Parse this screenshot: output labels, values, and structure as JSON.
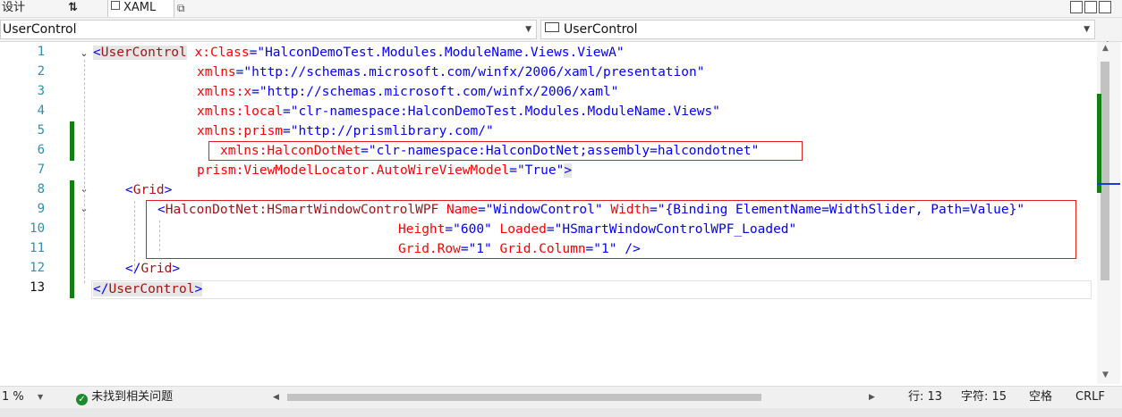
{
  "tabs": {
    "design": "设计",
    "swap_icon": "⇅",
    "xaml": "XAML",
    "open_icon": "popout-icon"
  },
  "nav": {
    "left_combo": "UserControl",
    "right_combo": "UserControl",
    "split_icon": "⇟"
  },
  "line_numbers": [
    "1",
    "2",
    "3",
    "4",
    "5",
    "6",
    "7",
    "8",
    "9",
    "10",
    "11",
    "12",
    "13"
  ],
  "code": {
    "l1_tag": "UserControl",
    "l1_attr": "x:Class",
    "l1_val": "\"HalconDemoTest.Modules.ModuleName.Views.ViewA\"",
    "l2_attr": "xmlns",
    "l2_val": "\"http://schemas.microsoft.com/winfx/2006/xaml/presentation\"",
    "l3_attr": "xmlns:x",
    "l3_val": "\"http://schemas.microsoft.com/winfx/2006/xaml\"",
    "l4_attr": "xmlns:local",
    "l4_val": "\"clr-namespace:HalconDemoTest.Modules.ModuleName.Views\"",
    "l5_attr": "xmlns:prism",
    "l5_val": "\"http://prismlibrary.com/\"",
    "l6_attr": "xmlns:HalconDotNet",
    "l6_val": "\"clr-namespace:HalconDotNet;assembly=halcondotnet\"",
    "l7_attr": "prism:ViewModelLocator.AutoWireViewModel",
    "l7_val": "\"True\"",
    "l8_tag": "Grid",
    "l9_tag": "HalconDotNet:HSmartWindowControlWPF",
    "l9_attr1": "Name",
    "l9_val1": "\"WindowControl\"",
    "l9_attr2": "Width",
    "l9_val2": "\"{Binding ElementName=WidthSlider, Path=Value}\"",
    "l10_attr1": "Height",
    "l10_val1": "\"600\"",
    "l10_attr2": "Loaded",
    "l10_val2": "\"HSmartWindowControlWPF_Loaded\"",
    "l11_attr1": "Grid.Row",
    "l11_val1": "\"1\"",
    "l11_attr2": "Grid.Column",
    "l11_val2": "\"1\"",
    "l12_tag": "Grid",
    "l13_tag": "UserControl"
  },
  "status": {
    "zoom": "1 %",
    "issues": "未找到相关问题",
    "line": "行: 13",
    "char": "字符: 15",
    "spacing": "空格",
    "eol": "CRLF"
  },
  "colors": {
    "tag": "#a31515",
    "attr": "#ff0000",
    "value": "#0000ff",
    "change_bar": "#108010",
    "highlight_box": "#e02020"
  }
}
